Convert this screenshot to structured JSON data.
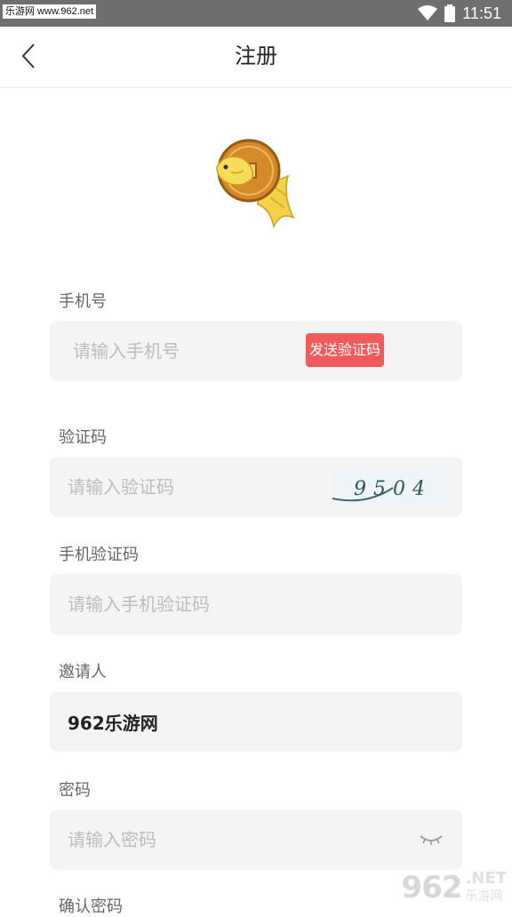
{
  "status_bar": {
    "watermark": "乐游网 www.962.net",
    "time": "11:51",
    "icons": [
      "wifi-icon",
      "battery-icon"
    ]
  },
  "nav": {
    "back_icon": "chevron-left-icon",
    "title": "注册"
  },
  "logo": {
    "icon": "golden-carp-coin-logo"
  },
  "form": {
    "phone": {
      "label": "手机号",
      "placeholder": "请输入手机号",
      "send_code_label": "发送验证码"
    },
    "captcha": {
      "label": "验证码",
      "placeholder": "请输入验证码",
      "image_text": "9504"
    },
    "sms_code": {
      "label": "手机验证码",
      "placeholder": "请输入手机验证码"
    },
    "inviter": {
      "label": "邀请人",
      "value": "962乐游网"
    },
    "password": {
      "label": "密码",
      "placeholder": "请输入密码",
      "toggle_icon": "eye-closed-icon"
    },
    "confirm_password": {
      "label": "确认密码"
    }
  },
  "watermark": {
    "number": "962",
    "net": ".NET",
    "name": "乐游网"
  },
  "colors": {
    "accent": "#f15b5b",
    "field_bg": "#f4f4f4",
    "status_bar": "#6f6f6f"
  }
}
